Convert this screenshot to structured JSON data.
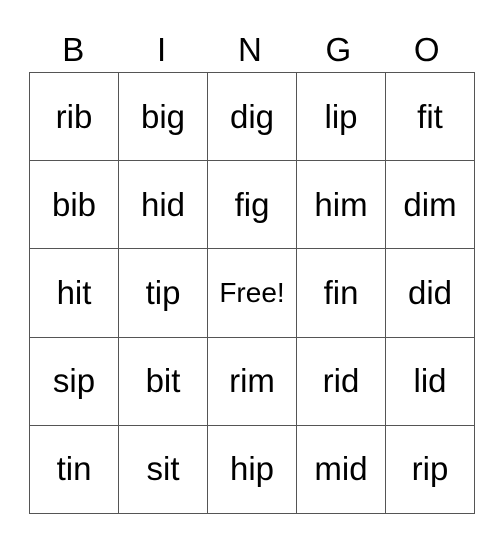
{
  "header": [
    "B",
    "I",
    "N",
    "G",
    "O"
  ],
  "rows": [
    [
      "rib",
      "big",
      "dig",
      "lip",
      "fit"
    ],
    [
      "bib",
      "hid",
      "fig",
      "him",
      "dim"
    ],
    [
      "hit",
      "tip",
      "Free!",
      "fin",
      "did"
    ],
    [
      "sip",
      "bit",
      "rim",
      "rid",
      "lid"
    ],
    [
      "tin",
      "sit",
      "hip",
      "mid",
      "rip"
    ]
  ]
}
